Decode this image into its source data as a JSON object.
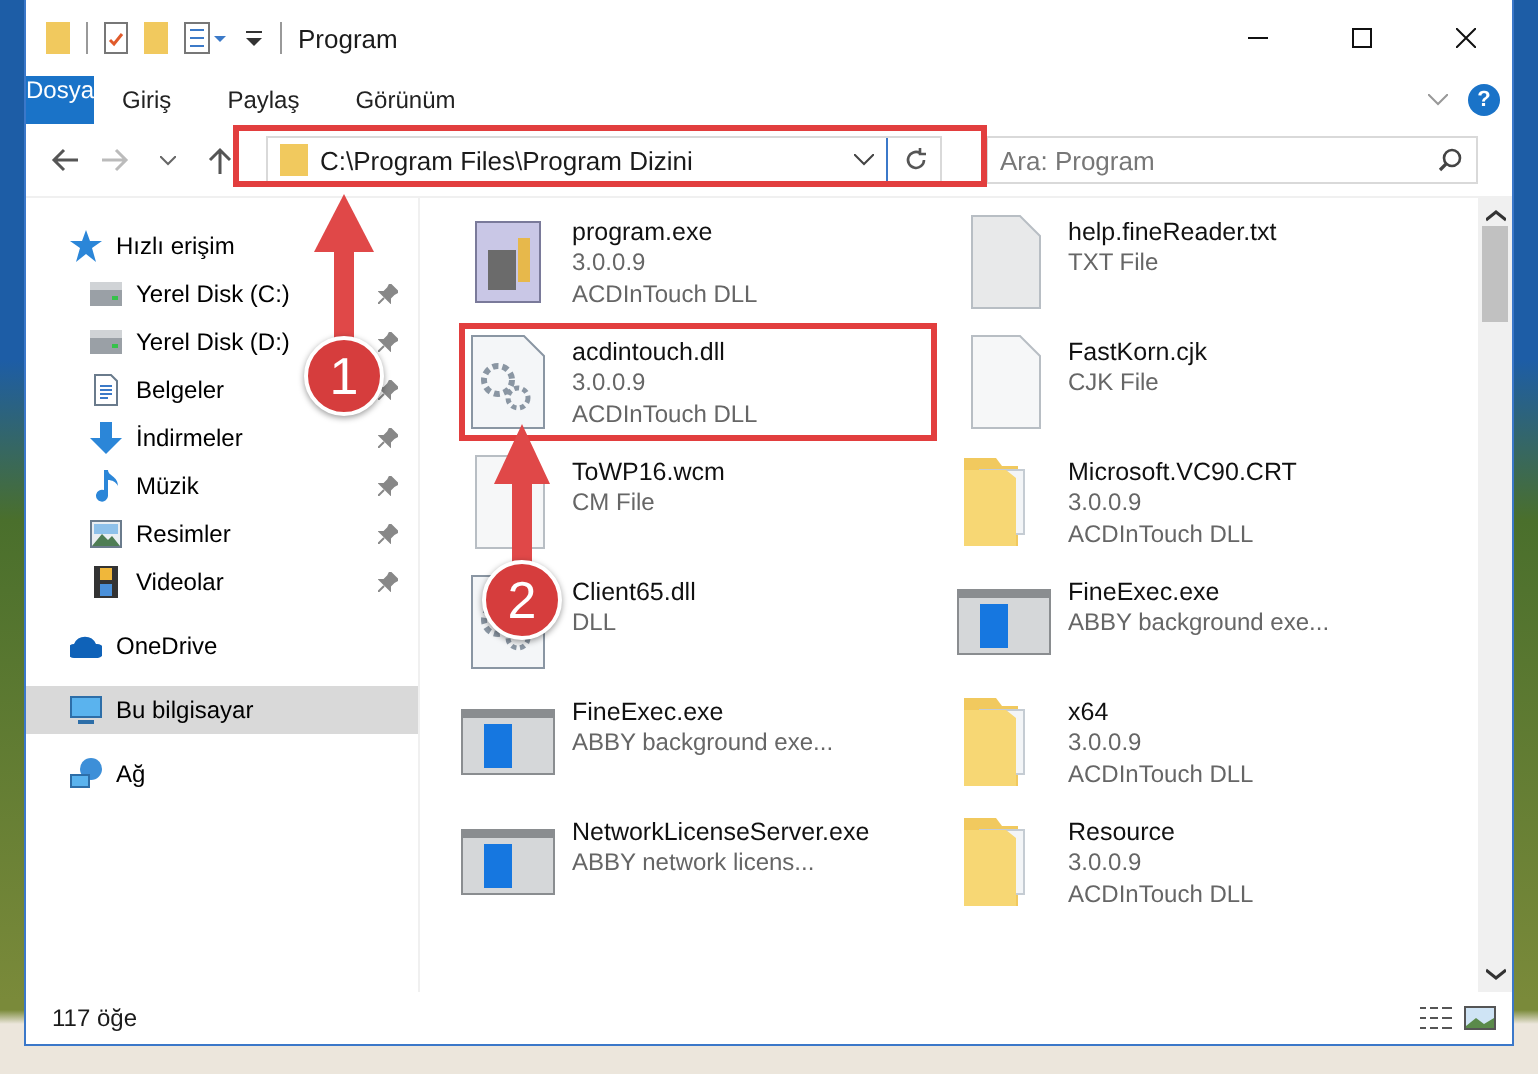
{
  "window": {
    "title": "Program"
  },
  "ribbon": {
    "tabs": [
      {
        "label": "Dosya",
        "kind": "file",
        "selected": false
      },
      {
        "label": "Giriş",
        "kind": "tab",
        "selected": false
      },
      {
        "label": "Paylaş",
        "kind": "tab",
        "selected": false
      },
      {
        "label": "Görünüm",
        "kind": "tab",
        "selected": false
      }
    ],
    "help": "?"
  },
  "address": {
    "path": "C:\\Program Files\\Program Dizini"
  },
  "search": {
    "placeholder": "Ara: Program"
  },
  "sidebar": {
    "items": [
      {
        "label": "Hızlı erişim",
        "kind": "star",
        "selected": false,
        "children": [
          {
            "label": "Yerel Disk (C:)",
            "kind": "drive",
            "pinned": true,
            "selected": false
          },
          {
            "label": "Yerel Disk (D:)",
            "kind": "drive",
            "pinned": true,
            "selected": false
          },
          {
            "label": "Belgeler",
            "kind": "document",
            "pinned": true,
            "selected": false
          },
          {
            "label": "İndirmeler",
            "kind": "download",
            "pinned": true,
            "selected": false
          },
          {
            "label": "Müzik",
            "kind": "music",
            "pinned": true,
            "selected": false
          },
          {
            "label": "Resimler",
            "kind": "image",
            "pinned": true,
            "selected": false
          },
          {
            "label": "Videolar",
            "kind": "film",
            "pinned": true,
            "selected": false
          }
        ]
      },
      {
        "label": "OneDrive",
        "kind": "cloud",
        "selected": false
      },
      {
        "label": "Bu bilgisayar",
        "kind": "computer",
        "selected": true
      },
      {
        "label": "Ağ",
        "kind": "network",
        "selected": false
      }
    ]
  },
  "files": [
    {
      "name": "program.exe",
      "details": [
        "3.0.0.9",
        "ACDInTouch DLL"
      ],
      "kind": "exe"
    },
    {
      "name": "help.fineReader.txt",
      "details": [
        "TXT File"
      ],
      "kind": "txt"
    },
    {
      "name": "acdintouch.dll",
      "details": [
        "3.0.0.9",
        "ACDInTouch DLL"
      ],
      "kind": "dll"
    },
    {
      "name": "FastKorn.cjk",
      "details": [
        "CJK File"
      ],
      "kind": "doc"
    },
    {
      "name": "ToWP16.wcm",
      "details": [
        "CM File"
      ],
      "kind": "doc"
    },
    {
      "name": "Microsoft.VC90.CRT",
      "details": [
        "3.0.0.9",
        "ACDInTouch DLL"
      ],
      "kind": "folder"
    },
    {
      "name": "Client65.dll",
      "details": [
        "DLL"
      ],
      "kind": "dll"
    },
    {
      "name": "FineExec.exe",
      "details": [
        "ABBY background exe..."
      ],
      "kind": "app"
    },
    {
      "name": "FineExec.exe",
      "details": [
        "ABBY background exe..."
      ],
      "kind": "app"
    },
    {
      "name": "x64",
      "details": [
        "3.0.0.9",
        "ACDInTouch DLL"
      ],
      "kind": "folder"
    },
    {
      "name": "NetworkLicenseServer.exe",
      "details": [
        "ABBY network licens..."
      ],
      "kind": "app"
    },
    {
      "name": "Resource",
      "details": [
        "3.0.0.9",
        "ACDInTouch DLL"
      ],
      "kind": "folder"
    }
  ],
  "status_bar": {
    "count": "117 öğe"
  },
  "callouts": [
    {
      "number": "1"
    },
    {
      "number": "2"
    }
  ]
}
